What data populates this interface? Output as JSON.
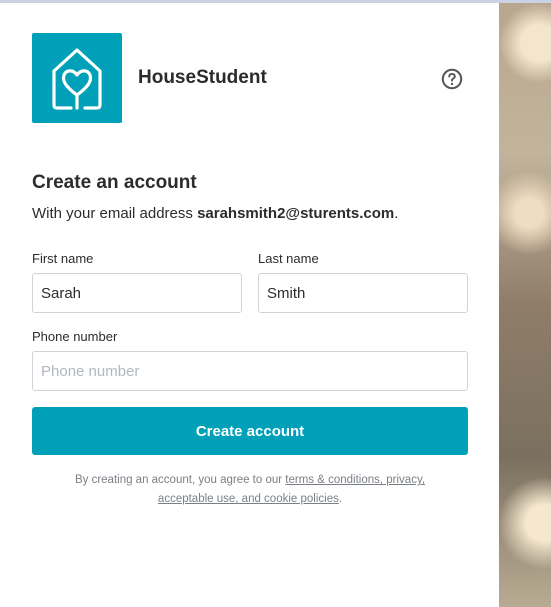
{
  "brand": {
    "name": "HouseStudent",
    "logo_icon": "house-heart-icon",
    "logo_color": "#00a1b8"
  },
  "header": {
    "help_icon": "question-circle-icon"
  },
  "form": {
    "title": "Create an account",
    "subtitle_prefix": "With your email address ",
    "email": "sarahsmith2@sturents.com",
    "subtitle_suffix": ".",
    "first_name": {
      "label": "First name",
      "value": "Sarah"
    },
    "last_name": {
      "label": "Last name",
      "value": "Smith"
    },
    "phone": {
      "label": "Phone number",
      "value": "",
      "placeholder": "Phone number"
    },
    "submit_label": "Create account",
    "accent_color": "#00a1b8"
  },
  "terms": {
    "prefix": "By creating an account, you agree to our ",
    "link1": "terms & conditions, privacy,",
    "link2": "acceptable use, and cookie policies",
    "suffix": "."
  }
}
